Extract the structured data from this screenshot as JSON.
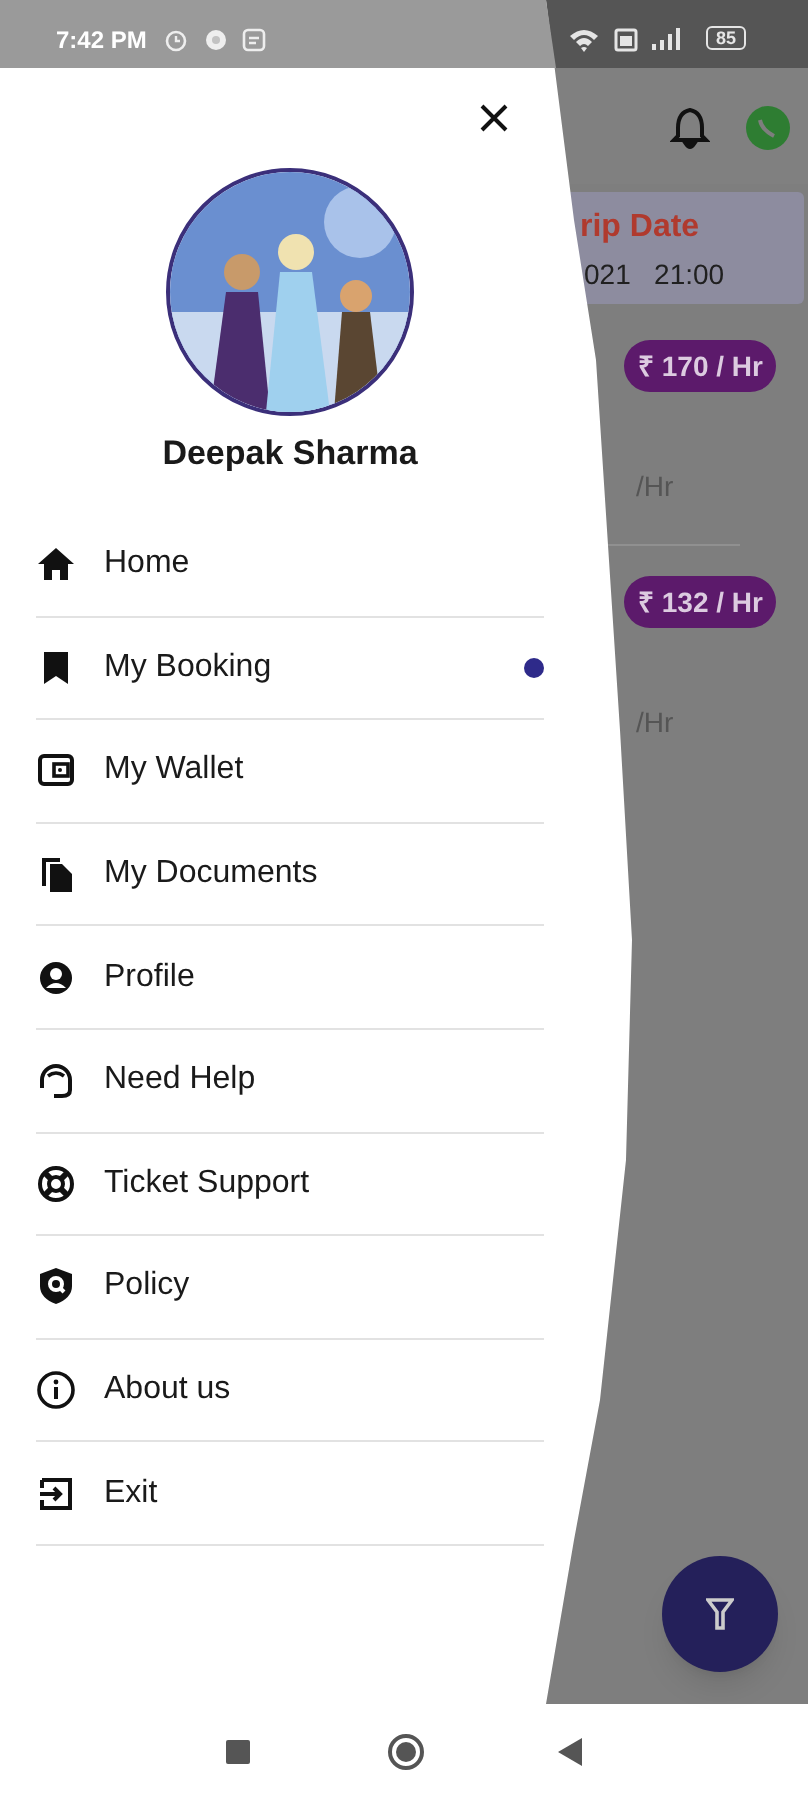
{
  "status_bar": {
    "time": "7:42 PM",
    "battery": "85"
  },
  "drawer": {
    "user_name": "Deepak Sharma",
    "items": [
      {
        "label": "Home",
        "dot": false
      },
      {
        "label": "My Booking",
        "dot": true
      },
      {
        "label": "My Wallet",
        "dot": false
      },
      {
        "label": "My Documents",
        "dot": false
      },
      {
        "label": "Profile",
        "dot": false
      },
      {
        "label": "Need Help",
        "dot": false
      },
      {
        "label": "Ticket Support",
        "dot": false
      },
      {
        "label": "Policy",
        "dot": false
      },
      {
        "label": "About us",
        "dot": false
      },
      {
        "label": "Exit",
        "dot": false
      }
    ]
  },
  "background": {
    "trip_card": {
      "title": "rip Date",
      "datetime": "021   21:00"
    },
    "rates": [
      {
        "badge": "₹ 170 / Hr",
        "rate": "/Hr"
      },
      {
        "badge": "₹ 132 / Hr",
        "rate": "/Hr"
      }
    ]
  }
}
